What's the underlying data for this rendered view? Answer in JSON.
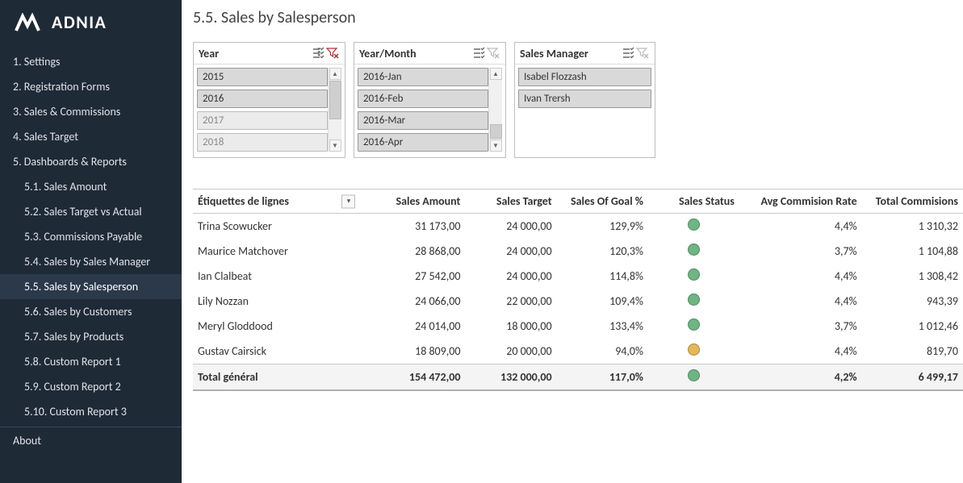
{
  "logo": {
    "text": "ADNIA"
  },
  "nav": {
    "items": [
      "1. Settings",
      "2. Registration Forms",
      "3. Sales & Commissions",
      "4. Sales Target",
      "5. Dashboards & Reports"
    ],
    "subitems": [
      "5.1. Sales Amount",
      "5.2. Sales Target vs Actual",
      "5.3. Commissions Payable",
      "5.4. Sales by Sales Manager",
      "5.5. Sales by Salesperson",
      "5.6. Sales by Customers",
      "5.7. Sales by Products",
      "5.8. Custom Report 1",
      "5.9. Custom Report 2",
      "5.10. Custom Report 3"
    ],
    "about": "About"
  },
  "page": {
    "title": "5.5. Sales by Salesperson"
  },
  "slicers": {
    "year": {
      "title": "Year",
      "options": [
        "2015",
        "2016",
        "2017",
        "2018"
      ],
      "selected": [
        "2015",
        "2016"
      ]
    },
    "year_month": {
      "title": "Year/Month",
      "options": [
        "2016-Jan",
        "2016-Feb",
        "2016-Mar",
        "2016-Apr"
      ],
      "selected": [
        "2016-Jan",
        "2016-Feb",
        "2016-Mar",
        "2016-Apr"
      ]
    },
    "sales_manager": {
      "title": "Sales Manager",
      "options": [
        "Isabel Flozzash",
        "Ivan Trersh"
      ],
      "selected": [
        "Isabel Flozzash",
        "Ivan Trersh"
      ]
    }
  },
  "table": {
    "headers": {
      "label": "Étiquettes de lignes",
      "amount": "Sales Amount",
      "target": "Sales Target",
      "goal": "Sales Of Goal %",
      "status": "Sales Status",
      "rate": "Avg Commision Rate",
      "comm": "Total Commisions"
    },
    "rows": [
      {
        "label": "Trina Scowucker",
        "amount": "31 173,00",
        "target": "24 000,00",
        "goal": "129,9%",
        "status": "green",
        "rate": "4,4%",
        "comm": "1 310,32"
      },
      {
        "label": "Maurice Matchover",
        "amount": "28 868,00",
        "target": "24 000,00",
        "goal": "120,3%",
        "status": "green",
        "rate": "3,7%",
        "comm": "1 104,88"
      },
      {
        "label": "Ian Clalbeat",
        "amount": "27 542,00",
        "target": "24 000,00",
        "goal": "114,8%",
        "status": "green",
        "rate": "4,4%",
        "comm": "1 308,42"
      },
      {
        "label": "Lily Nozzan",
        "amount": "24 066,00",
        "target": "22 000,00",
        "goal": "109,4%",
        "status": "green",
        "rate": "4,4%",
        "comm": "943,39"
      },
      {
        "label": "Meryl Gloddood",
        "amount": "24 014,00",
        "target": "18 000,00",
        "goal": "133,4%",
        "status": "green",
        "rate": "3,7%",
        "comm": "1 012,46"
      },
      {
        "label": "Gustav Cairsick",
        "amount": "18 809,00",
        "target": "20 000,00",
        "goal": "94,0%",
        "status": "amber",
        "rate": "4,4%",
        "comm": "819,70"
      }
    ],
    "total": {
      "label": "Total général",
      "amount": "154 472,00",
      "target": "132 000,00",
      "goal": "117,0%",
      "status": "green",
      "rate": "4,2%",
      "comm": "6 499,17"
    }
  }
}
